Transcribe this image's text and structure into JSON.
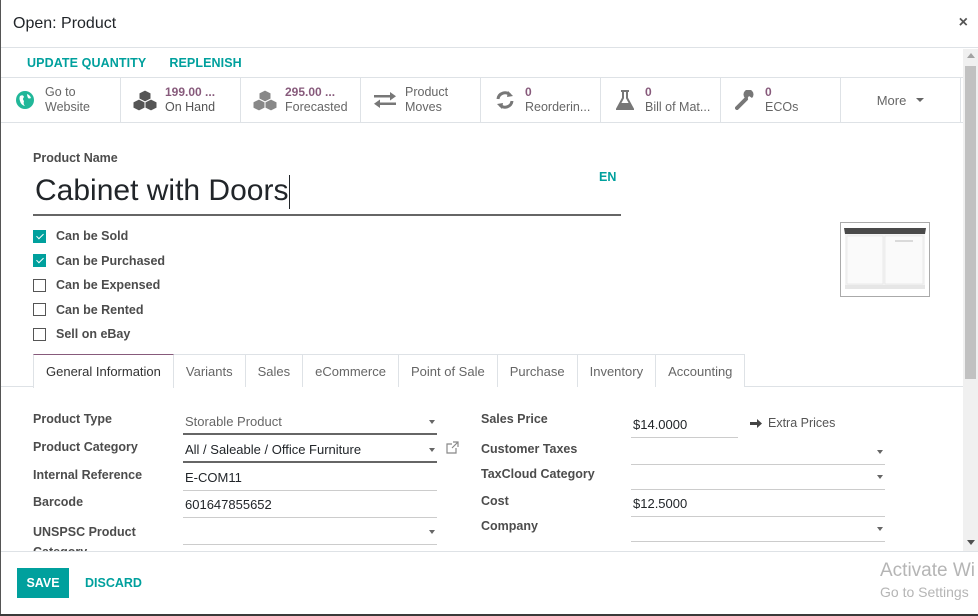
{
  "modal": {
    "title": "Open: Product",
    "close_label": "×"
  },
  "statusbar": {
    "buttons": [
      "UPDATE QUANTITY",
      "REPLENISH"
    ]
  },
  "smart_buttons": [
    {
      "icon": "globe-icon",
      "value": "",
      "line1": "Go to",
      "line2": "Website",
      "color": "#21b799"
    },
    {
      "icon": "cubes-icon",
      "value": "199.00 ...",
      "line2": "On Hand"
    },
    {
      "icon": "cubes-icon",
      "value": "295.00 ...",
      "line2": "Forecasted"
    },
    {
      "icon": "exchange-icon",
      "value": "",
      "line1": "Product",
      "line2": "Moves"
    },
    {
      "icon": "refresh-icon",
      "value": "0",
      "line2": "Reorderin..."
    },
    {
      "icon": "flask-icon",
      "value": "0",
      "line2": "Bill of Mat..."
    },
    {
      "icon": "wrench-icon",
      "value": "0",
      "line2": "ECOs"
    }
  ],
  "more_label": "More",
  "product": {
    "name_label": "Product Name",
    "name": "Cabinet with Doors",
    "lang": "EN",
    "image_alt": "Cabinet with Doors product image"
  },
  "checkboxes": [
    {
      "label": "Can be Sold",
      "checked": true
    },
    {
      "label": "Can be Purchased",
      "checked": true
    },
    {
      "label": "Can be Expensed",
      "checked": false
    },
    {
      "label": "Can be Rented",
      "checked": false
    },
    {
      "label": "Sell on eBay",
      "checked": false
    }
  ],
  "tabs": [
    {
      "label": "General Information",
      "active": true
    },
    {
      "label": "Variants"
    },
    {
      "label": "Sales"
    },
    {
      "label": "eCommerce"
    },
    {
      "label": "Point of Sale"
    },
    {
      "label": "Purchase"
    },
    {
      "label": "Inventory"
    },
    {
      "label": "Accounting"
    }
  ],
  "left_fields": [
    {
      "label": "Product Type",
      "value": "Storable Product",
      "type": "select"
    },
    {
      "label": "Product Category",
      "value": "All / Saleable / Office Furniture",
      "type": "many2one"
    },
    {
      "label": "Internal Reference",
      "value": "E-COM11",
      "type": "text"
    },
    {
      "label": "Barcode",
      "value": "601647855652",
      "type": "text"
    },
    {
      "label": "UNSPSC Product Category",
      "value": "",
      "type": "many2one"
    }
  ],
  "right_fields": [
    {
      "label": "Sales Price",
      "value": "$14.0000",
      "type": "monetary"
    },
    {
      "label": "Customer Taxes",
      "value": "",
      "type": "many2many"
    },
    {
      "label": "TaxCloud Category",
      "value": "",
      "type": "many2one"
    },
    {
      "label": "Cost",
      "value": "$12.5000",
      "type": "monetary"
    },
    {
      "label": "Company",
      "value": "",
      "type": "many2one"
    }
  ],
  "extra_prices_label": "Extra Prices",
  "footer": {
    "save_label": "SAVE",
    "discard_label": "DISCARD"
  },
  "watermark": {
    "line1": "Activate Wi",
    "line2": "Go to Settings"
  },
  "colors": {
    "accent": "#00a09d",
    "brand_purple": "#875a7b"
  }
}
